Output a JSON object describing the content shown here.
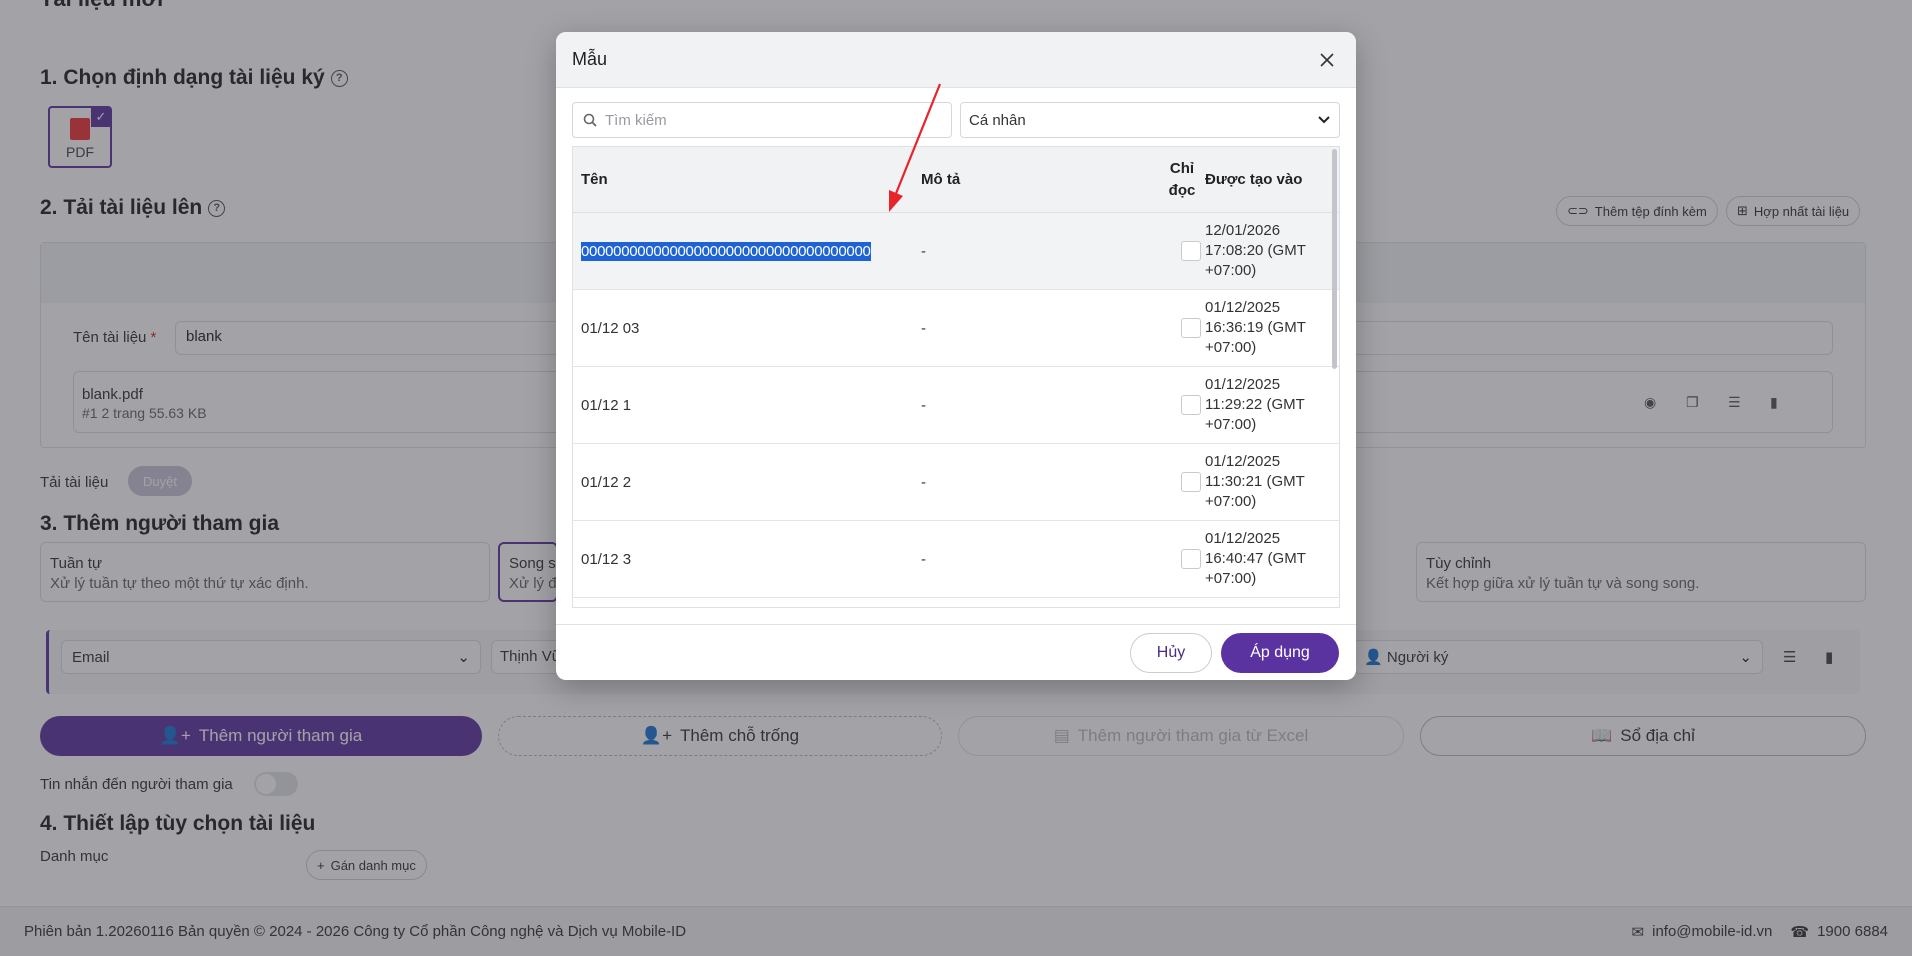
{
  "page": {
    "top_title": "Tài liệu mới",
    "section1": {
      "title": "1. Chọn định dạng tài liệu ký",
      "format_label": "PDF"
    },
    "section2": {
      "title": "2. Tải tài liệu lên",
      "attach_btn": "Thêm tệp đính kèm",
      "merge_btn": "Hợp nhất tài liệu",
      "doc_name_label": "Tên tài liệu",
      "required_mark": "*",
      "doc_name_value": "blank",
      "file_name": "blank.pdf",
      "file_meta": "#1  2 trang  55.63 KB",
      "upload_label": "Tải tài liệu",
      "browse_btn": "Duyệt"
    },
    "section3": {
      "title": "3. Thêm người tham gia",
      "modes": [
        {
          "name": "Tuần tự",
          "desc": "Xử lý tuần tự theo một thứ tự xác định."
        },
        {
          "name": "Song s",
          "desc": "Xử lý đ"
        },
        {
          "name": "Tùy chỉnh",
          "desc": "Kết hợp giữa xử lý tuần tự và song song."
        }
      ],
      "email_select": "Email",
      "name_value": "Thịnh Vũ",
      "role_select": "Người ký",
      "add_participant_btn": "Thêm người tham gia",
      "add_placeholder_btn": "Thêm chỗ trống",
      "add_excel_btn": "Thêm người tham gia từ Excel",
      "address_book_btn": "Sổ địa chỉ",
      "message_toggle_label": "Tin nhắn đến người tham gia"
    },
    "section4": {
      "title": "4. Thiết lập tùy chọn tài liệu",
      "category_label": "Danh mục",
      "assign_category_btn": "Gán danh mục"
    },
    "footer": {
      "copyright": "Phiên bản 1.20260116 Bản quyền © 2024 - 2026 Công ty Cổ phần Công nghệ và Dịch vụ Mobile-ID",
      "email": "info@mobile-id.vn",
      "phone": "1900 6884"
    }
  },
  "modal": {
    "title": "Mẫu",
    "search_placeholder": "Tìm kiếm",
    "filter_value": "Cá nhân",
    "columns": {
      "name": "Tên",
      "desc": "Mô tả",
      "readonly_l1": "Chỉ",
      "readonly_l2": "đọc",
      "created": "Được tạo vào"
    },
    "rows": [
      {
        "name": "000000000000000000000000000000000000",
        "desc": "-",
        "d1": "12/01/2026",
        "d2": "17:08:20 (GMT",
        "d3": "+07:00)"
      },
      {
        "name": "01/12 03",
        "desc": "-",
        "d1": "01/12/2025",
        "d2": "16:36:19 (GMT",
        "d3": "+07:00)"
      },
      {
        "name": "01/12 1",
        "desc": "-",
        "d1": "01/12/2025",
        "d2": "11:29:22 (GMT",
        "d3": "+07:00)"
      },
      {
        "name": "01/12 2",
        "desc": "-",
        "d1": "01/12/2025",
        "d2": "11:30:21 (GMT",
        "d3": "+07:00)"
      },
      {
        "name": "01/12 3",
        "desc": "-",
        "d1": "01/12/2025",
        "d2": "16:40:47 (GMT",
        "d3": "+07:00)"
      }
    ],
    "cancel_btn": "Hủy",
    "apply_btn": "Áp dụng"
  },
  "colors": {
    "accent": "#5b33a0",
    "selection": "#1e63d6",
    "annotation": "#e8232a"
  }
}
